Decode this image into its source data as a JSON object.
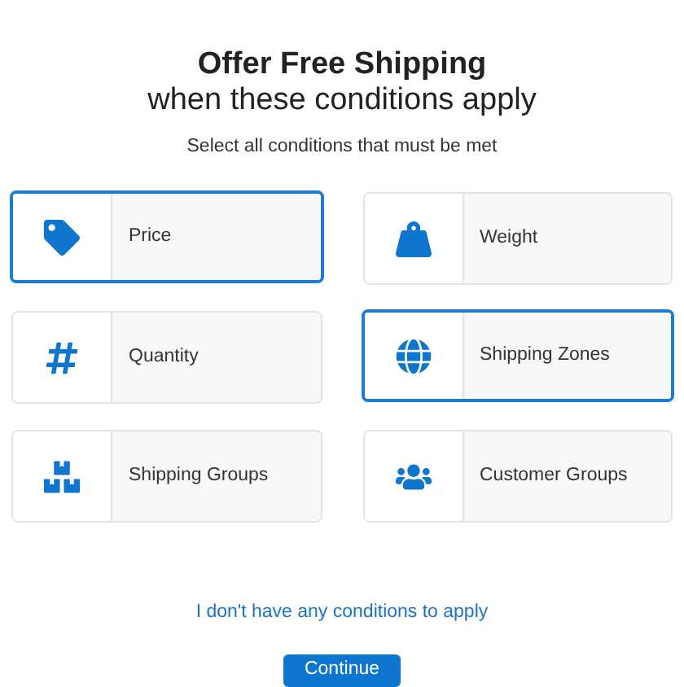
{
  "title": "Offer Free Shipping",
  "subtitle": "when these conditions apply",
  "instruction": "Select all conditions that must be met",
  "conditions": [
    {
      "label": "Price",
      "kind": "tag",
      "selected": true
    },
    {
      "label": "Weight",
      "kind": "weight",
      "selected": false
    },
    {
      "label": "Quantity",
      "kind": "hash",
      "selected": false
    },
    {
      "label": "Shipping Zones",
      "kind": "globe",
      "selected": true
    },
    {
      "label": "Shipping Groups",
      "kind": "boxes",
      "selected": false
    },
    {
      "label": "Customer Groups",
      "kind": "users",
      "selected": false
    }
  ],
  "skip_link": "I don't have any conditions to apply",
  "continue_button": "Continue"
}
